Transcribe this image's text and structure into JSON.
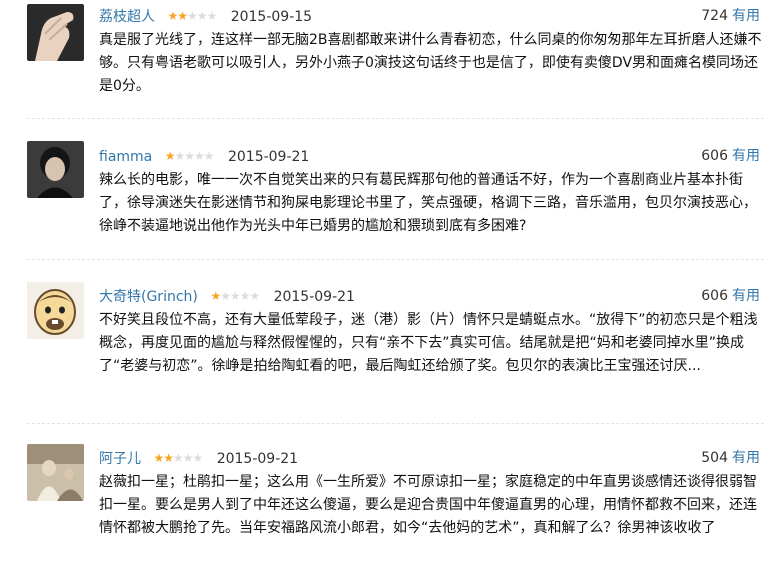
{
  "useful_label": "有用",
  "reviews": [
    {
      "user": "荔枝超人",
      "rating": 2,
      "date": "2015-09-15",
      "votes": "724",
      "text": "真是服了光线了，连这样一部无脑2B喜剧都敢来讲什么青春初恋，什么同桌的你匆匆那年左耳折磨人还嫌不够。只有粤语老歌可以吸引人，另外小燕子0演技这句话终于也是信了，即使有卖傻DV男和面瘫名模同场还是0分。",
      "avatar": "hand-photo"
    },
    {
      "user": "fiamma",
      "rating": 1,
      "date": "2015-09-21",
      "votes": "606",
      "text": "辣么长的电影，唯一一次不自觉笑出来的只有葛民辉那句他的普通话不好，作为一个喜剧商业片基本扑街了，徐导演迷失在影迷情节和狗屎电影理论书里了，笑点强硬，格调下三路，音乐滥用，包贝尔演技恶心，徐峥不装逼地说出他作为光头中年已婚男的尴尬和猥琐到底有多困难?",
      "avatar": "portrait-photo"
    },
    {
      "user": "大奇特(Grinch)",
      "rating": 1,
      "date": "2015-09-21",
      "votes": "606",
      "text": "不好笑且段位不高，还有大量低荤段子，迷（港）影（片）情怀只是蜻蜓点水。“放得下”的初恋只是个粗浅概念，再度见面的尴尬与释然假惺惺的，只有“亲不下去”真实可信。结尾就是把“妈和老婆同掉水里”换成了“老婆与初恋”。徐峥是拍给陶虹看的吧，最后陶虹还给颁了奖。包贝尔的表演比王宝强还讨厌...",
      "avatar": "cartoon-character"
    },
    {
      "user": "阿子儿",
      "rating": 2,
      "date": "2015-09-21",
      "votes": "504",
      "text": "赵薇扣一星；杜鹃扣一星；这么用《一生所爱》不可原谅扣一星；家庭稳定的中年直男谈感情还谈得很弱智扣一星。要么是男人到了中年还这么傻逼，要么是迎合贵国中年傻逼直男的心理，用情怀都救不回来，还连情怀都被大鹏抢了先。当年安福路风流小郎君，如今“去他妈的艺术”，真和解了么？徐男神该收收了",
      "avatar": "vintage-photo"
    }
  ]
}
